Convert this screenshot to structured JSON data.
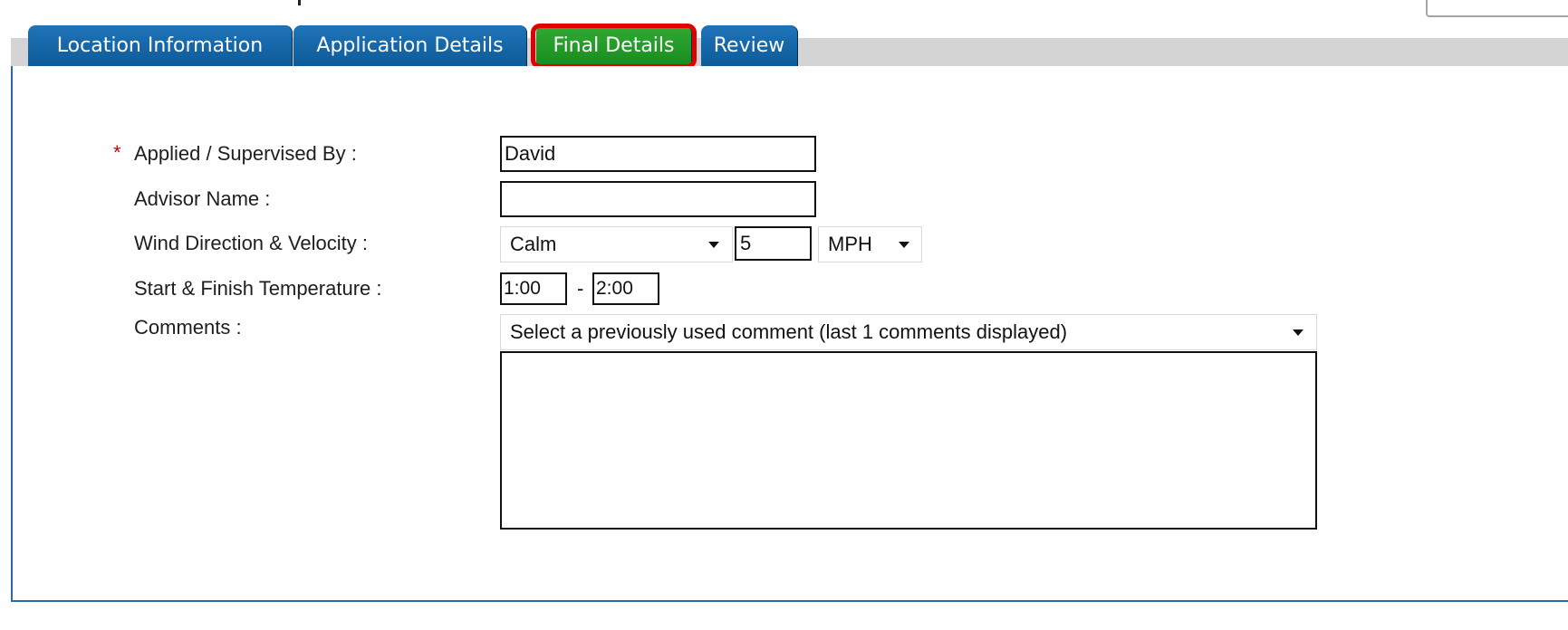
{
  "tabs": {
    "location_information": "Location Information",
    "application_details": "Application Details",
    "final_details": "Final Details",
    "review": "Review"
  },
  "form": {
    "required_marker": "*",
    "applied_supervised_by": {
      "label": "Applied / Supervised By :",
      "value": "David"
    },
    "advisor_name": {
      "label": "Advisor Name :",
      "value": ""
    },
    "wind": {
      "label": "Wind Direction & Velocity :",
      "direction": "Calm",
      "velocity": "5",
      "unit": "MPH"
    },
    "temperature": {
      "label": "Start & Finish Temperature :",
      "start": "1:00",
      "separator": "-",
      "finish": "2:00"
    },
    "comments": {
      "label": "Comments :",
      "previous_comment_select": "Select a previously used comment (last 1 comments displayed)",
      "value": ""
    }
  },
  "colors": {
    "tab_blue": "#0d5a98",
    "tab_green": "#168c1f",
    "highlight_red": "#e10000",
    "required_red": "#c90000",
    "panel_border": "#2a6aa5"
  },
  "icons": {
    "dropdown": "chevron-down-icon"
  }
}
